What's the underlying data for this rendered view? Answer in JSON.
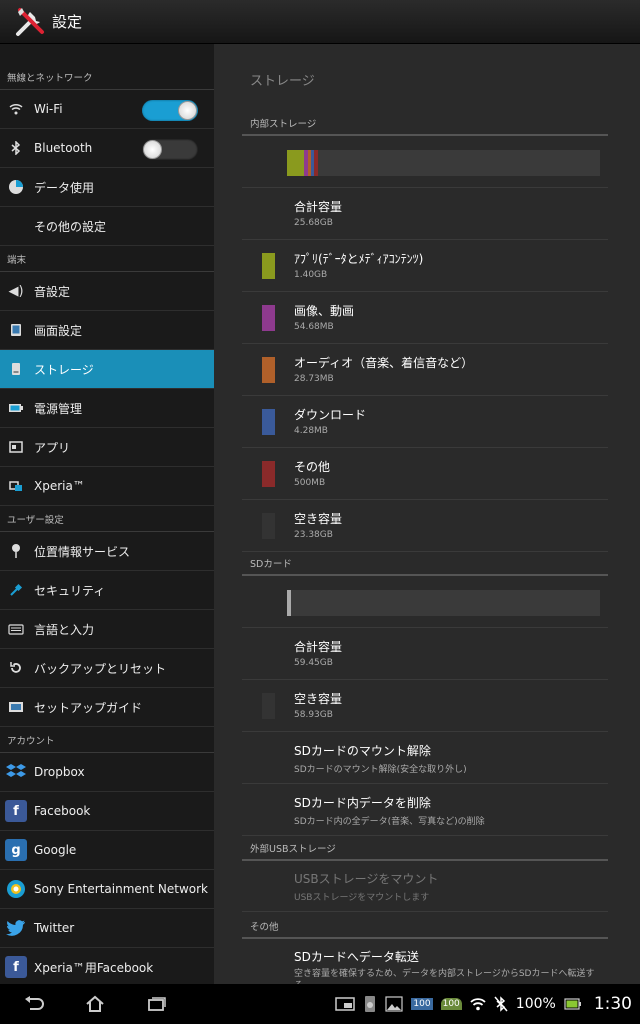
{
  "app": {
    "title": "設定"
  },
  "sidebar": {
    "sections": [
      {
        "header": "無線とネットワーク",
        "items": [
          {
            "label": "Wi-Fi",
            "icon": "wifi-icon",
            "toggle": "on"
          },
          {
            "label": "Bluetooth",
            "icon": "bluetooth-icon",
            "toggle": "off"
          },
          {
            "label": "データ使用",
            "icon": "data-usage-icon"
          },
          {
            "label": "その他の設定"
          }
        ]
      },
      {
        "header": "端末",
        "items": [
          {
            "label": "音設定",
            "icon": "sound-icon"
          },
          {
            "label": "画面設定",
            "icon": "display-icon"
          },
          {
            "label": "ストレージ",
            "icon": "storage-icon",
            "selected": true
          },
          {
            "label": "電源管理",
            "icon": "battery-icon"
          },
          {
            "label": "アプリ",
            "icon": "apps-icon"
          },
          {
            "label": "Xperia™",
            "icon": "xperia-icon"
          }
        ]
      },
      {
        "header": "ユーザー設定",
        "items": [
          {
            "label": "位置情報サービス",
            "icon": "location-icon"
          },
          {
            "label": "セキュリティ",
            "icon": "security-icon"
          },
          {
            "label": "言語と入力",
            "icon": "keyboard-icon"
          },
          {
            "label": "バックアップとリセット",
            "icon": "backup-icon"
          },
          {
            "label": "セットアップガイド",
            "icon": "setup-guide-icon"
          }
        ]
      },
      {
        "header": "アカウント",
        "items": [
          {
            "label": "Dropbox",
            "icon": "dropbox-icon"
          },
          {
            "label": "Facebook",
            "icon": "facebook-icon"
          },
          {
            "label": "Google",
            "icon": "google-icon"
          },
          {
            "label": "Sony Entertainment Network",
            "icon": "sony-entertainment-network-icon"
          },
          {
            "label": "Twitter",
            "icon": "twitter-icon"
          },
          {
            "label": "Xperia™用Facebook",
            "icon": "xperia-facebook-icon"
          }
        ]
      }
    ]
  },
  "content": {
    "title": "ストレージ",
    "internal": {
      "header": "内部ストレージ",
      "usage_bar": [
        {
          "color": "#8a9a1e",
          "fraction": 0.055
        },
        {
          "color": "#8e3a8e",
          "fraction": 0.012
        },
        {
          "color": "#b0602a",
          "fraction": 0.01
        },
        {
          "color": "#3a5a9a",
          "fraction": 0.01
        },
        {
          "color": "#8a2a2a",
          "fraction": 0.012
        }
      ],
      "total": {
        "title": "合計容量",
        "value": "25.68GB"
      },
      "items": [
        {
          "title": "ｱﾌﾟﾘ(ﾃﾞｰﾀとﾒﾃﾞｨｱｺﾝﾃﾝﾂ)",
          "value": "1.40GB",
          "color": "#8a9a1e"
        },
        {
          "title": "画像、動画",
          "value": "54.68MB",
          "color": "#8e3a8e"
        },
        {
          "title": "オーディオ（音楽、着信音など）",
          "value": "28.73MB",
          "color": "#b0602a"
        },
        {
          "title": "ダウンロード",
          "value": "4.28MB",
          "color": "#3a5a9a"
        },
        {
          "title": "その他",
          "value": "500MB",
          "color": "#8a2a2a"
        },
        {
          "title": "空き容量",
          "value": "23.38GB",
          "color": "#333333"
        }
      ]
    },
    "sd": {
      "header": "SDカード",
      "usage_bar": [
        {
          "color": "#aaaaaa",
          "fraction": 0.012
        }
      ],
      "total": {
        "title": "合計容量",
        "value": "59.45GB"
      },
      "free": {
        "title": "空き容量",
        "value": "58.93GB",
        "color": "#333333"
      },
      "unmount": {
        "title": "SDカードのマウント解除",
        "subtitle": "SDカードのマウント解除(安全な取り外し)"
      },
      "erase": {
        "title": "SDカード内データを削除",
        "subtitle": "SDカード内の全データ(音楽、写真など)の削除"
      }
    },
    "usb": {
      "header": "外部USBストレージ",
      "mount": {
        "title": "USBストレージをマウント",
        "subtitle": "USBストレージをマウントします"
      }
    },
    "other": {
      "header": "その他",
      "transfer": {
        "title": "SDカードへデータ転送",
        "subtitle": "空き容量を確保するため、データを内部ストレージからSDカードへ転送する"
      }
    }
  },
  "statusbar": {
    "battery_percent": "100%",
    "time": "1:30",
    "badge_a": "100",
    "badge_b": "100"
  }
}
